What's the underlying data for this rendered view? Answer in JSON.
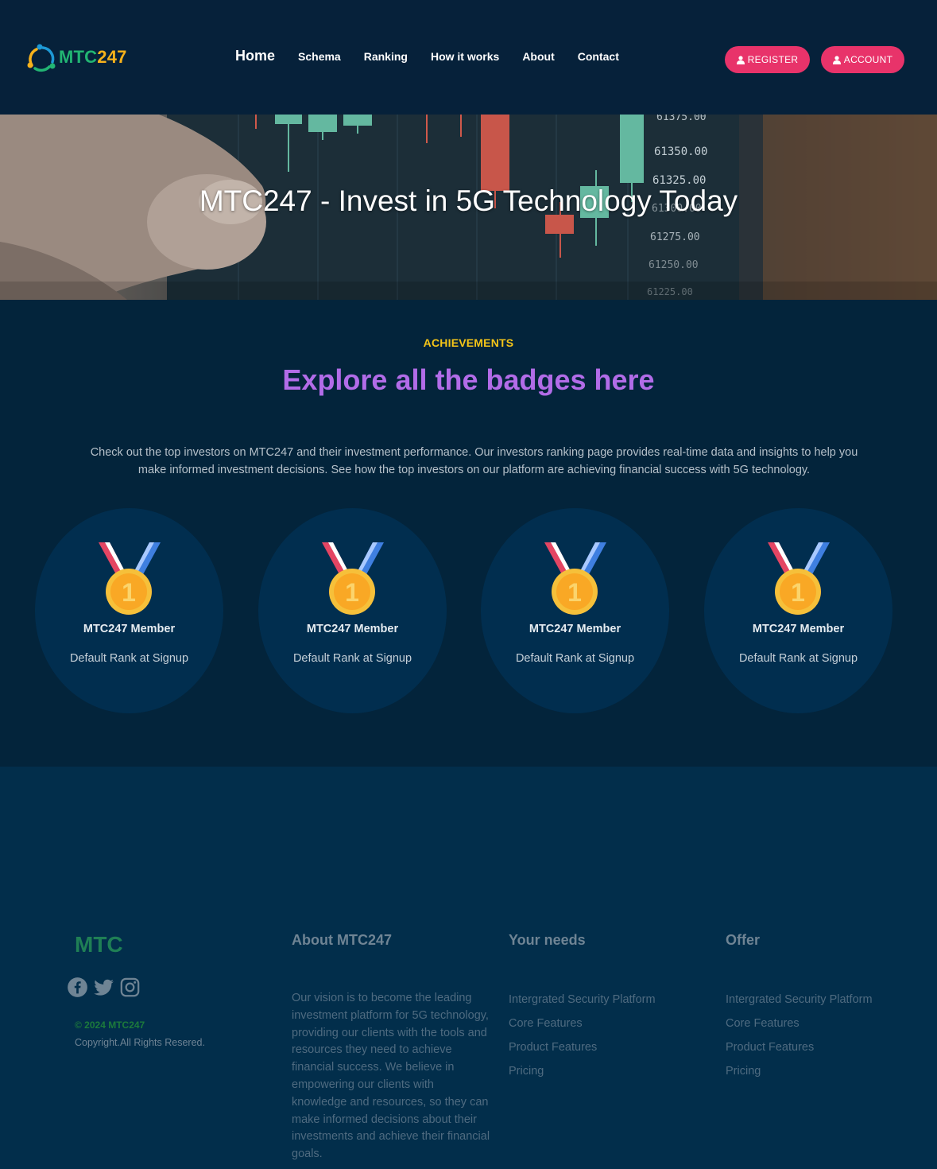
{
  "header": {
    "logo_text_a": "MTC",
    "logo_text_b": "247",
    "nav": [
      "Home",
      "Schema",
      "Ranking",
      "How it works",
      "About",
      "Contact"
    ],
    "register_label": "REGISTER",
    "account_label": "ACCOUNT"
  },
  "hero": {
    "title": "MTC247 - Invest in 5G Technology Today",
    "price_labels": [
      "61375.00",
      "61350.00",
      "61325.00",
      "61300.00",
      "61275.00",
      "61250.00",
      "61225.00"
    ]
  },
  "achievements": {
    "kicker": "ACHIEVEMENTS",
    "title": "Explore all the badges here",
    "description": "Check out the top investors on MTC247 and their investment performance. Our investors ranking page provides real-time data and insights to help you make informed investment decisions. See how the top investors on our platform are achieving financial success with 5G technology.",
    "badges": [
      {
        "name": "MTC247 Member",
        "rank": "Default Rank at Signup",
        "medal_number": "1"
      },
      {
        "name": "MTC247 Member",
        "rank": "Default Rank at Signup",
        "medal_number": "1"
      },
      {
        "name": "MTC247 Member",
        "rank": "Default Rank at Signup",
        "medal_number": "1"
      },
      {
        "name": "MTC247 Member",
        "rank": "Default Rank at Signup",
        "medal_number": "1"
      }
    ]
  },
  "footer": {
    "brand": "MTC",
    "social_icons": [
      "facebook-icon",
      "twitter-icon",
      "instagram-icon"
    ],
    "year": "© 2024 MTC247",
    "copyright": "Copyright.All Rights Resered.",
    "about_title": "About MTC247",
    "about_text": "Our vision is to become the leading investment platform for 5G technology, providing our clients with the tools and resources they need to achieve financial success. We believe in empowering our clients with knowledge and resources, so they can make informed decisions about their investments and achieve their financial goals.",
    "needs_title": "Your needs",
    "needs_items": [
      "Intergrated Security Platform",
      "Core Features",
      "Product Features",
      "Pricing"
    ],
    "offer_title": "Offer",
    "offer_items": [
      "Intergrated Security Platform",
      "Core Features",
      "Product Features",
      "Pricing"
    ]
  },
  "colors": {
    "accent_pink": "#e8336a",
    "kicker_yellow": "#f5c518",
    "title_purple": "#b26ce8",
    "brand_green": "#22b573"
  }
}
